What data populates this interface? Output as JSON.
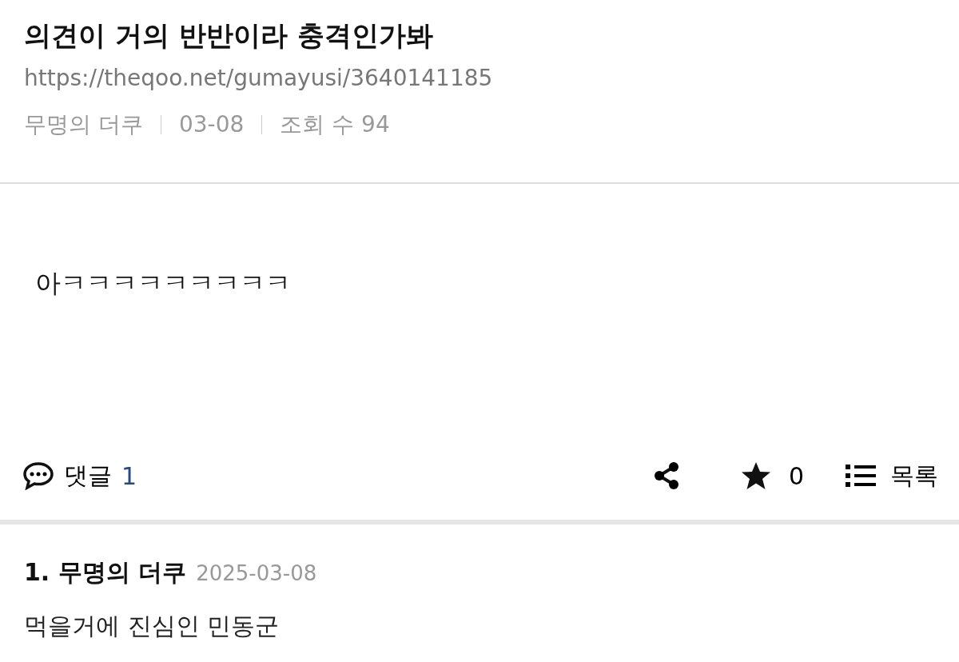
{
  "post": {
    "title": "의견이 거의 반반이라 충격인가봐",
    "url": "https://theqoo.net/gumayusi/3640141185",
    "author": "무명의 더쿠",
    "date": "03-08",
    "views": "조회 수 94",
    "body": "아ㅋㅋㅋㅋㅋㅋㅋㅋㅋ"
  },
  "actions": {
    "comments_label": "댓글",
    "comments_count": "1",
    "stars_count": "0",
    "list_label": "목록"
  },
  "comments": [
    {
      "number": "1.",
      "author": "무명의 더쿠",
      "date": "2025-03-08",
      "text": "먹을거에 진심인 민동군"
    }
  ]
}
